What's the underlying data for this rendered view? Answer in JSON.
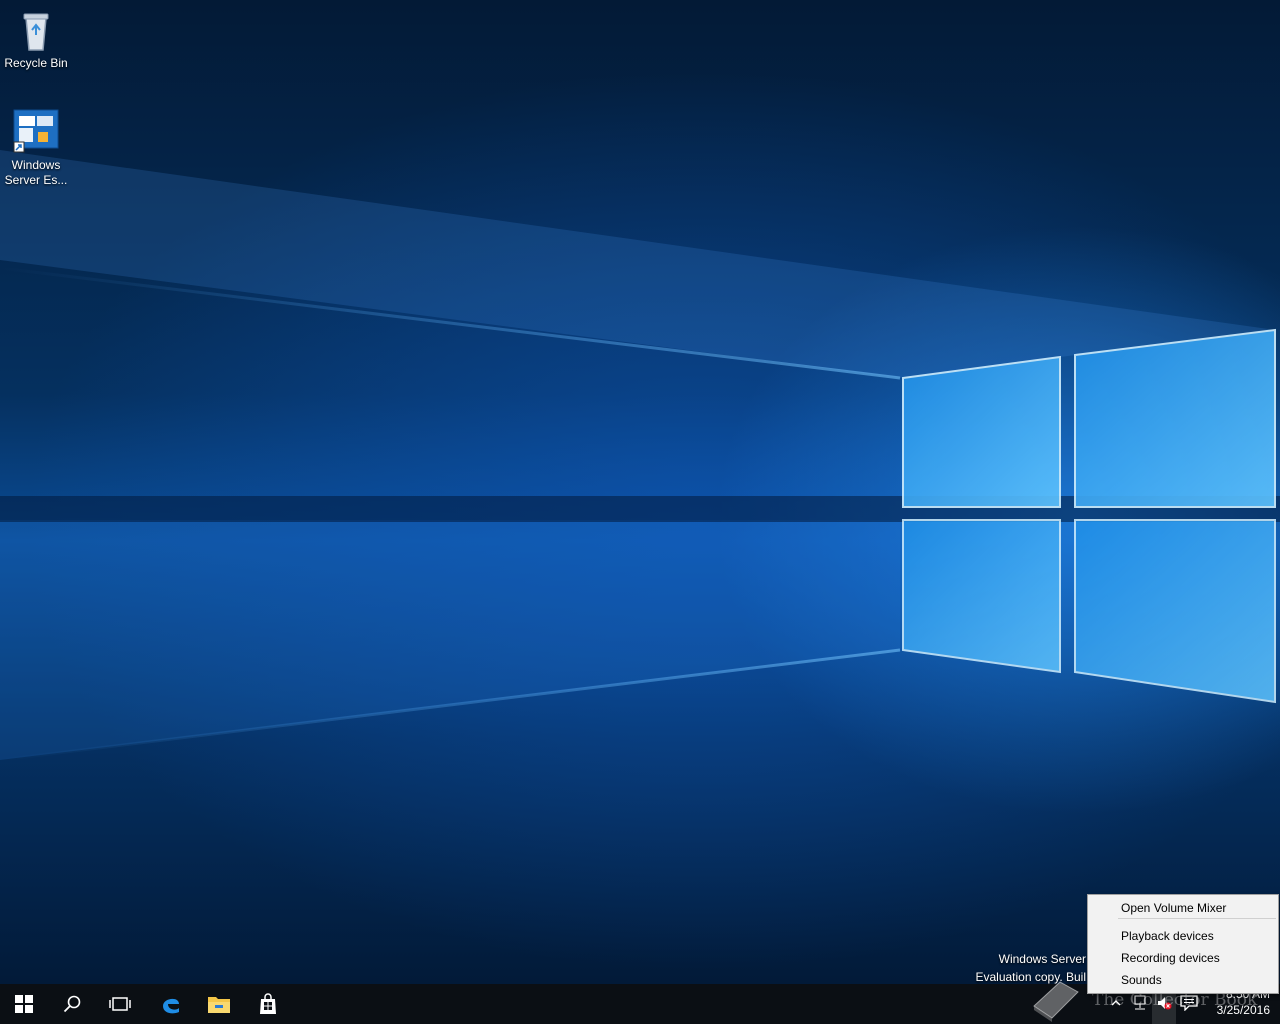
{
  "desktop": {
    "icons": [
      {
        "label": "Recycle Bin"
      },
      {
        "label_line1": "Windows",
        "label_line2": "Server Es..."
      }
    ]
  },
  "watermark": {
    "line1": "Windows Server",
    "line2": "Evaluation copy. Buil"
  },
  "context_menu": {
    "items": [
      "Open Volume Mixer",
      "Playback devices",
      "Recording devices",
      "Sounds"
    ]
  },
  "clock": {
    "time": "8:50 AM",
    "date": "3/25/2016"
  },
  "overlay_logo": {
    "text": "The Collector Book"
  },
  "taskbar": {
    "icons": [
      "windows-start-icon",
      "search-icon",
      "task-view-icon",
      "edge-icon",
      "file-explorer-icon",
      "store-icon"
    ]
  },
  "tray": {
    "icons": [
      "chevron-up-icon",
      "network-icon",
      "volume-muted-icon",
      "action-center-icon"
    ]
  }
}
